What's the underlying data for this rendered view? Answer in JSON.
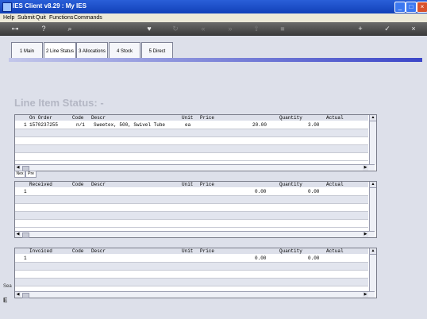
{
  "window": {
    "title": "IES Client v8.29 : My IES"
  },
  "menu": [
    "Help",
    "Submit",
    "Quit",
    "Functions",
    "Commands"
  ],
  "toolbar_icons": [
    "key-icon",
    "help-icon",
    "search-icon",
    "heart-icon",
    "refresh-icon",
    "rewind-icon",
    "forward-icon",
    "upload-icon",
    "stop-icon",
    "add-icon",
    "ok-icon",
    "cancel-icon"
  ],
  "tabs": [
    {
      "label": "1 Main",
      "active": false
    },
    {
      "label": "2 Line Status",
      "active": true
    },
    {
      "label": "3 Allocations",
      "active": false
    },
    {
      "label": "4 Stock",
      "active": false
    },
    {
      "label": "5 Direct",
      "active": false
    }
  ],
  "page_title": "Line Item Status: -",
  "grid1": {
    "headers": [
      "On Order",
      "Code",
      "Descr",
      "Unit",
      "Price",
      "Quantity",
      "Actual"
    ],
    "rows": [
      {
        "idx": "1",
        "order": "1570237255",
        "code": "n/1",
        "descr": "Sweetex, 500, Swivel Tube",
        "unit": "ea",
        "price": "20.00",
        "quantity": "3.00"
      }
    ]
  },
  "grid1_nav": {
    "prev": "Nex",
    "next": "Pre"
  },
  "grid2": {
    "headers": [
      "Received",
      "Code",
      "Descr",
      "Unit",
      "Price",
      "Quantity",
      "Actual"
    ],
    "rows": [
      {
        "idx": "1",
        "price": "0.00",
        "quantity": "0.00"
      }
    ]
  },
  "grid3": {
    "headers": [
      "Invoiced",
      "Code",
      "Descr",
      "Unit",
      "Price",
      "Quantity",
      "Actual"
    ],
    "rows": [
      {
        "idx": "1",
        "price": "0.00",
        "quantity": "0.00"
      }
    ]
  },
  "side_strip": {
    "top": "Sea",
    "bottom": "E"
  }
}
